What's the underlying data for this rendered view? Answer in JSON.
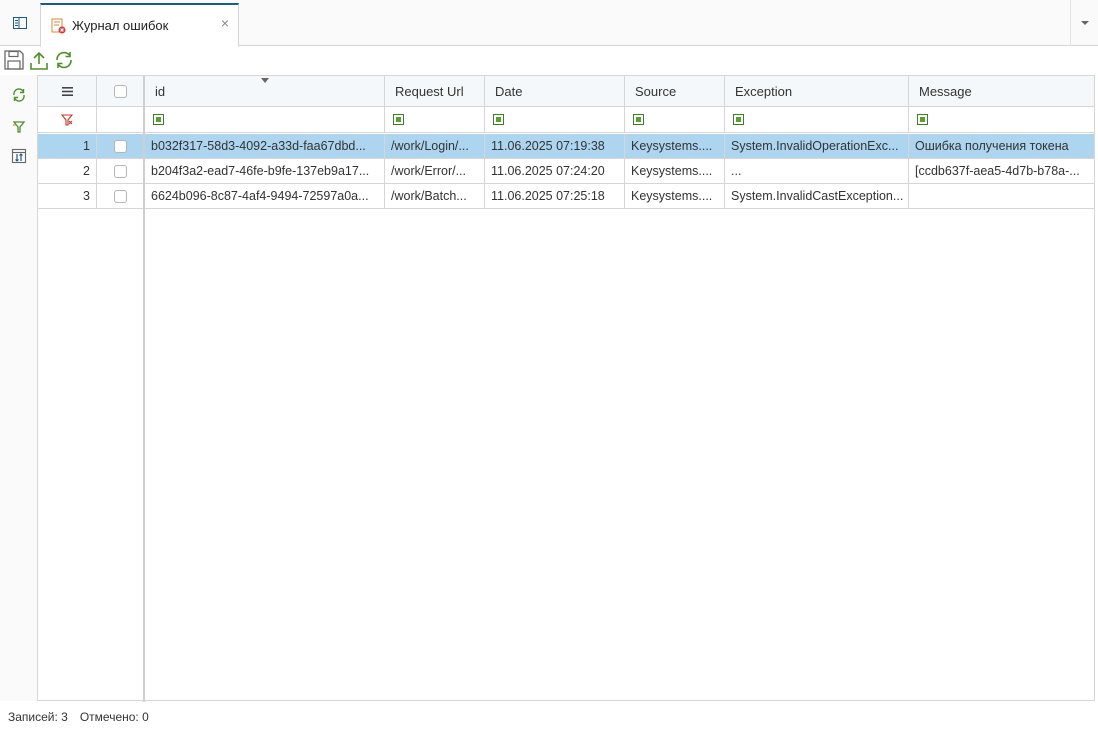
{
  "tab": {
    "title": "Журнал ошибок",
    "close_glyph": "×"
  },
  "grid": {
    "columns": [
      "id",
      "Request Url",
      "Date",
      "Source",
      "Exception",
      "Message"
    ],
    "rows": [
      {
        "num": "1",
        "id": "b032f317-58d3-4092-a33d-faa67dbd...",
        "url": "/work/Login/...",
        "date": "11.06.2025 07:19:38",
        "source": "Keysystems....",
        "exception": "System.InvalidOperationExc...",
        "message": "Ошибка получения токена",
        "selected": true
      },
      {
        "num": "2",
        "id": "b204f3a2-ead7-46fe-b9fe-137eb9a17...",
        "url": "/work/Error/...",
        "date": "11.06.2025 07:24:20",
        "source": "Keysystems....",
        "exception": "...",
        "message": "[ccdb637f-aea5-4d7b-b78a-...",
        "selected": false
      },
      {
        "num": "3",
        "id": "6624b096-8c87-4af4-9494-72597a0a...",
        "url": "/work/Batch...",
        "date": "11.06.2025 07:25:18",
        "source": "Keysystems....",
        "exception": "System.InvalidCastException...",
        "message": "",
        "selected": false
      }
    ]
  },
  "status": {
    "records": "Записей: 3",
    "checked": "Отмечено: 0"
  },
  "icons": {
    "home": "grid-view-icon",
    "tab": "error-log-icon",
    "save": "save-icon",
    "upload": "upload-icon",
    "refresh": "refresh-icon",
    "filter": "filter-icon",
    "column_settings": "column-settings-icon",
    "menu": "hamburger-menu-icon"
  },
  "colors": {
    "accent": "#1b5a8c",
    "selected_row": "#add5f0",
    "green": "#5a9e2f"
  }
}
